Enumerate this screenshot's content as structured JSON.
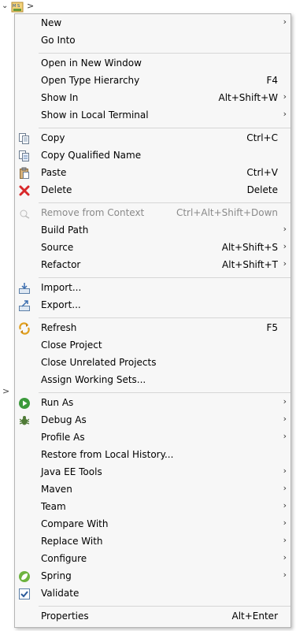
{
  "tree": {
    "twisty": "⌄",
    "arrow": ">",
    "side_twisty": ">"
  },
  "menu": {
    "items": [
      {
        "label": "New",
        "accel": "",
        "arrow": "›"
      },
      {
        "label": "Go Into",
        "accel": "",
        "arrow": ""
      },
      {
        "label": "Open in New Window",
        "accel": "",
        "arrow": ""
      },
      {
        "label": "Open Type Hierarchy",
        "accel": "F4",
        "arrow": ""
      },
      {
        "label": "Show In",
        "accel": "Alt+Shift+W",
        "arrow": "›"
      },
      {
        "label": "Show in Local Terminal",
        "accel": "",
        "arrow": "›"
      },
      {
        "label": "Copy",
        "accel": "Ctrl+C",
        "arrow": ""
      },
      {
        "label": "Copy Qualified Name",
        "accel": "",
        "arrow": ""
      },
      {
        "label": "Paste",
        "accel": "Ctrl+V",
        "arrow": ""
      },
      {
        "label": "Delete",
        "accel": "Delete",
        "arrow": ""
      },
      {
        "label": "Remove from Context",
        "accel": "Ctrl+Alt+Shift+Down",
        "arrow": ""
      },
      {
        "label": "Build Path",
        "accel": "",
        "arrow": "›"
      },
      {
        "label": "Source",
        "accel": "Alt+Shift+S",
        "arrow": "›"
      },
      {
        "label": "Refactor",
        "accel": "Alt+Shift+T",
        "arrow": "›"
      },
      {
        "label": "Import...",
        "accel": "",
        "arrow": ""
      },
      {
        "label": "Export...",
        "accel": "",
        "arrow": ""
      },
      {
        "label": "Refresh",
        "accel": "F5",
        "arrow": ""
      },
      {
        "label": "Close Project",
        "accel": "",
        "arrow": ""
      },
      {
        "label": "Close Unrelated Projects",
        "accel": "",
        "arrow": ""
      },
      {
        "label": "Assign Working Sets...",
        "accel": "",
        "arrow": ""
      },
      {
        "label": "Run As",
        "accel": "",
        "arrow": "›"
      },
      {
        "label": "Debug As",
        "accel": "",
        "arrow": "›"
      },
      {
        "label": "Profile As",
        "accel": "",
        "arrow": "›"
      },
      {
        "label": "Restore from Local History...",
        "accel": "",
        "arrow": ""
      },
      {
        "label": "Java EE Tools",
        "accel": "",
        "arrow": "›"
      },
      {
        "label": "Maven",
        "accel": "",
        "arrow": "›"
      },
      {
        "label": "Team",
        "accel": "",
        "arrow": "›"
      },
      {
        "label": "Compare With",
        "accel": "",
        "arrow": "›"
      },
      {
        "label": "Replace With",
        "accel": "",
        "arrow": "›"
      },
      {
        "label": "Configure",
        "accel": "",
        "arrow": "›"
      },
      {
        "label": "Spring",
        "accel": "",
        "arrow": "›"
      },
      {
        "label": "Validate",
        "accel": "",
        "arrow": ""
      },
      {
        "label": "Properties",
        "accel": "Alt+Enter",
        "arrow": ""
      }
    ]
  }
}
